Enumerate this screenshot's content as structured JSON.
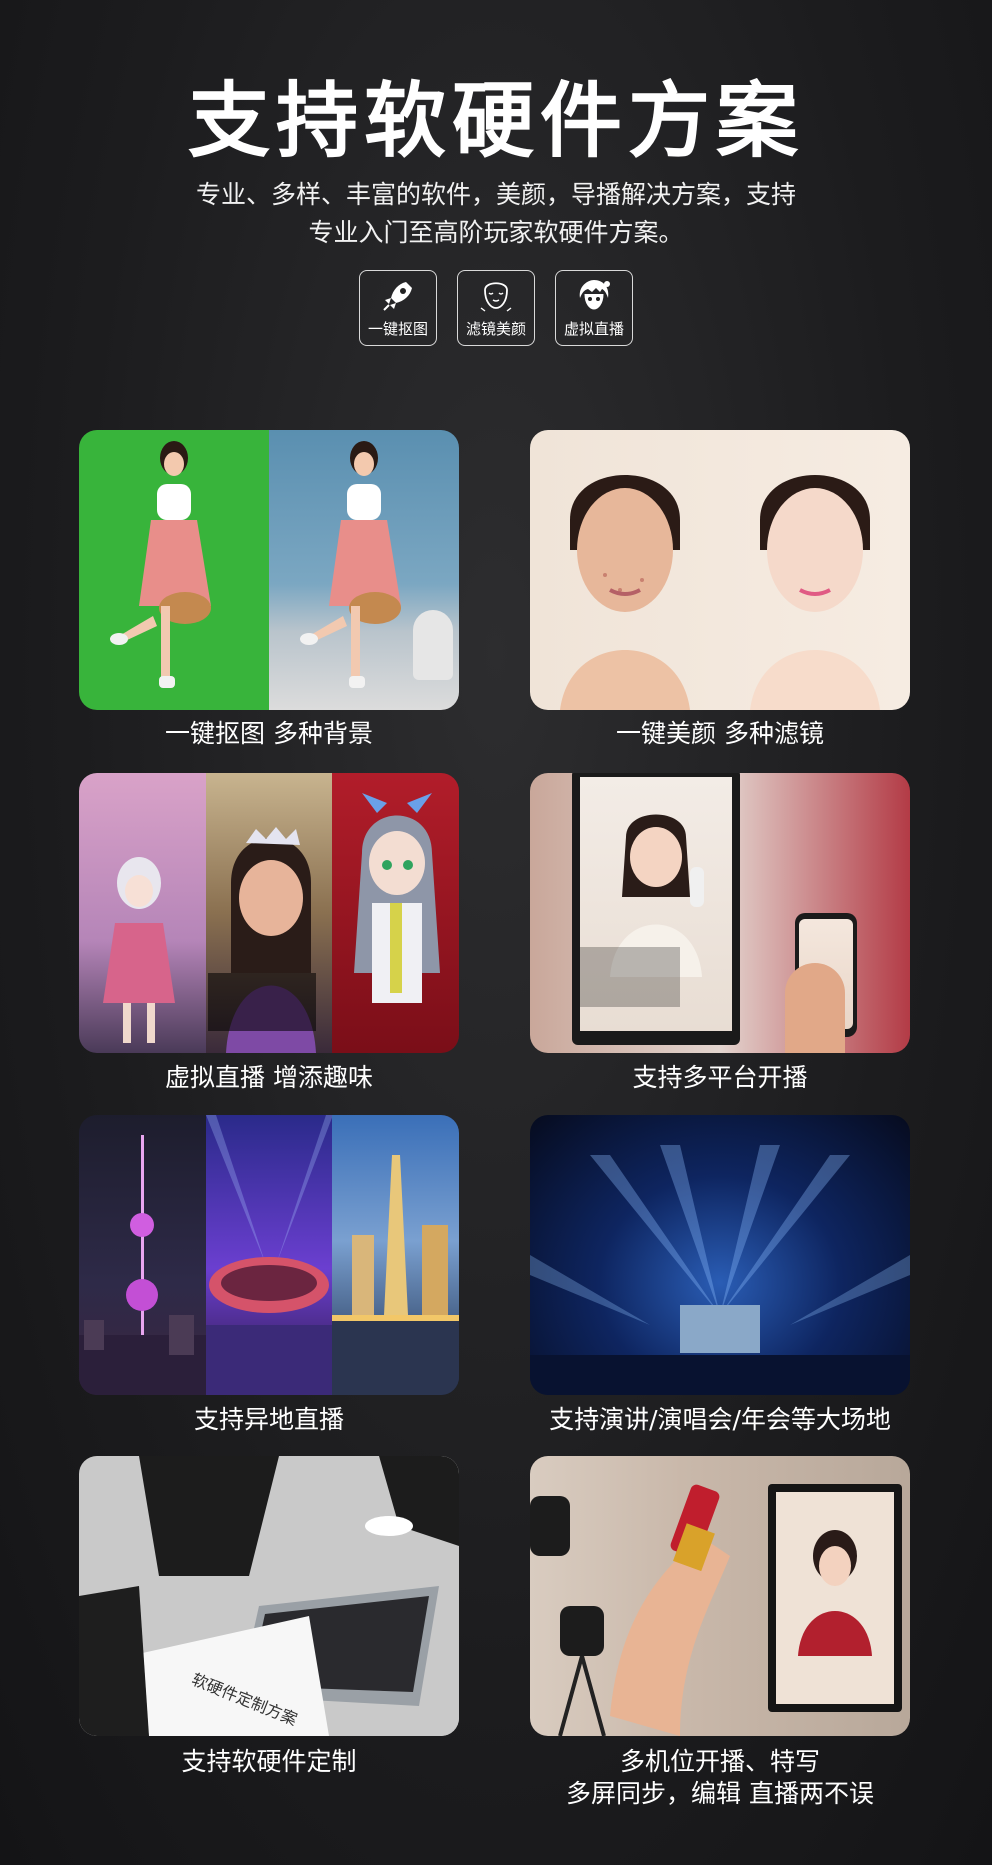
{
  "header": {
    "title": "支持软硬件方案",
    "subtitle_line1": "专业、多样、丰富的软件，美颜，导播解决方案，支持",
    "subtitle_line2": "专业入门至高阶玩家软硬件方案。"
  },
  "features": [
    {
      "label": "一键抠图",
      "icon": "rocket-icon"
    },
    {
      "label": "滤镜美颜",
      "icon": "face-icon"
    },
    {
      "label": "虚拟直播",
      "icon": "avatar-icon"
    }
  ],
  "cards": [
    {
      "caption": "一键抠图 多种背景"
    },
    {
      "caption": "一键美颜 多种滤镜"
    },
    {
      "caption": "虚拟直播 增添趣味"
    },
    {
      "caption": "支持多平台开播"
    },
    {
      "caption": "支持异地直播"
    },
    {
      "caption": "支持演讲/演唱会/年会等大场地"
    },
    {
      "caption": "支持软硬件定制"
    },
    {
      "caption_line1": "多机位开播、特写",
      "caption_line2": "多屏同步，编辑 直播两不误"
    }
  ],
  "paper_text": "软硬件定制方案",
  "colors": {
    "background": "#1c1c1e",
    "text": "#ffffff",
    "greenscreen": "#36b63a"
  }
}
